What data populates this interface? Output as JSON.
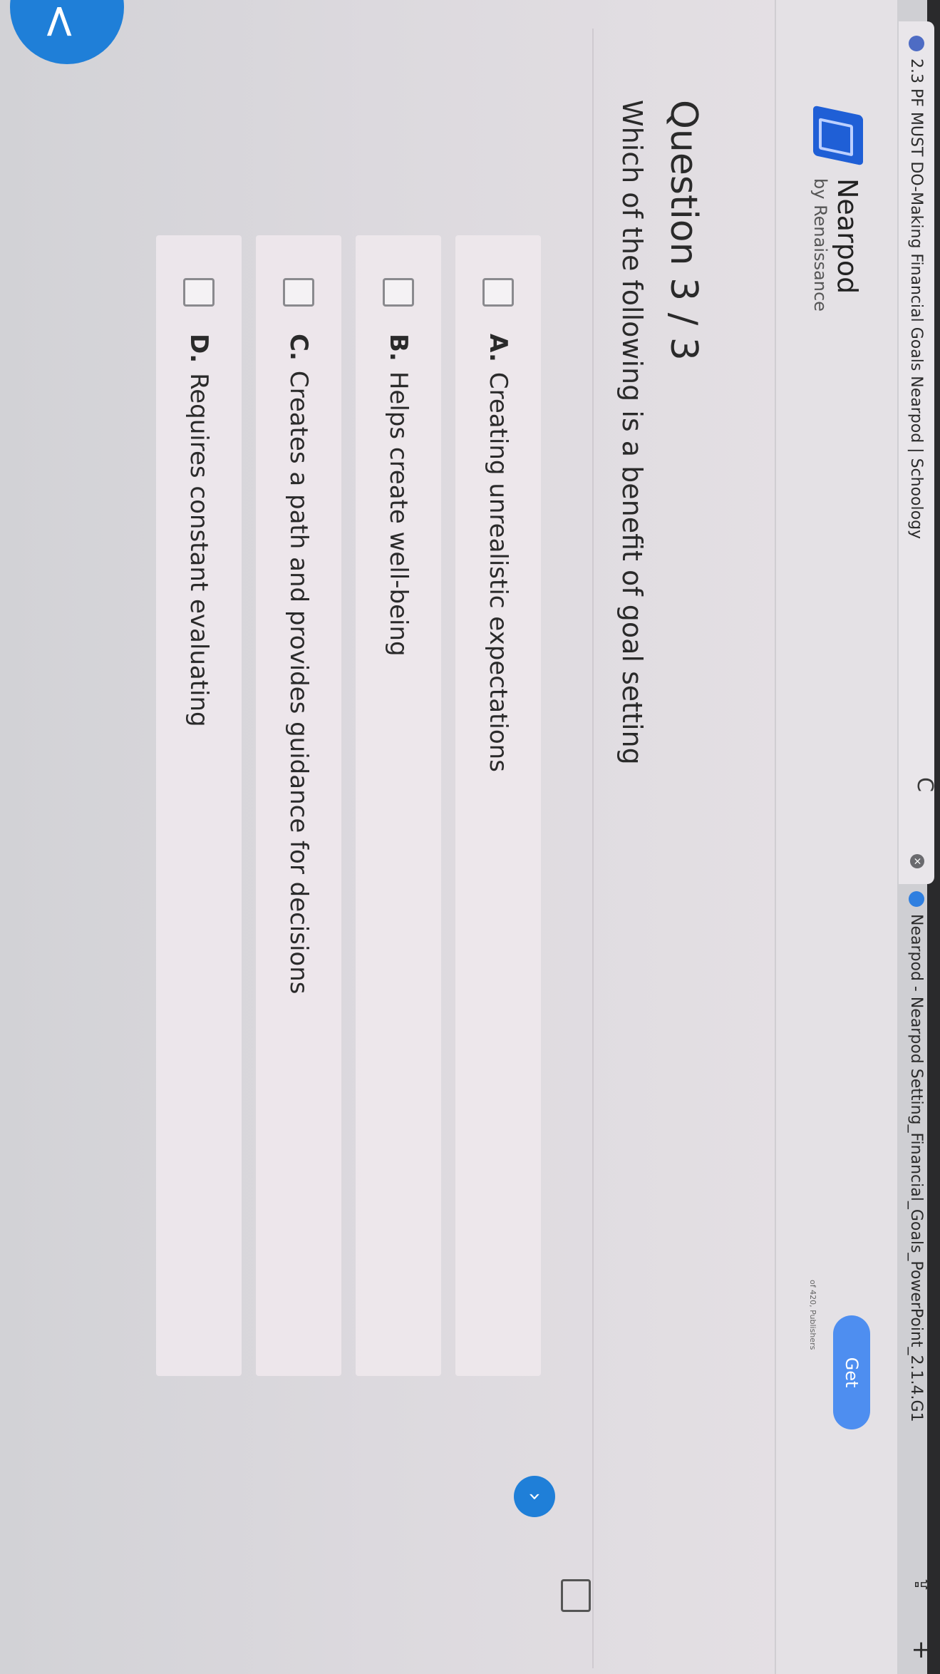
{
  "browser": {
    "tabs": [
      {
        "title": "2.3 PF MUST DO-Making Financial Goals Nearpod | Schoology",
        "active": true
      },
      {
        "title": "Nearpod - Nearpod Setting_Financial_Goals_PowerPoint_2.1.4.G1",
        "active": false
      }
    ],
    "new_tab_symbol": "+",
    "share_symbol": "⇪",
    "reload_symbol": "C"
  },
  "header": {
    "brand_name": "Nearpod",
    "brand_sub": "by Renaissance",
    "get_label": "Get",
    "publisher_label": "of 420, Publishers"
  },
  "question": {
    "title": "Question 3 / 3",
    "text": "Which of the following is a benefit of goal setting"
  },
  "options": [
    {
      "letter": "A.",
      "text": "Creating unrealistic expectations"
    },
    {
      "letter": "B.",
      "text": "Helps create well-being"
    },
    {
      "letter": "C.",
      "text": "Creates a path and provides guidance for decisions"
    },
    {
      "letter": "D.",
      "text": "Requires constant evaluating"
    }
  ],
  "icons": [
    "nearpod-logo-icon",
    "back-chevron-icon",
    "next-chevron-icon",
    "fullscreen-icon",
    "close-icon",
    "reload-icon",
    "share-icon",
    "plus-icon"
  ],
  "colors": {
    "accent": "#1f7fd8",
    "get_button": "#4e8ef0",
    "background": "#dcd9de"
  }
}
